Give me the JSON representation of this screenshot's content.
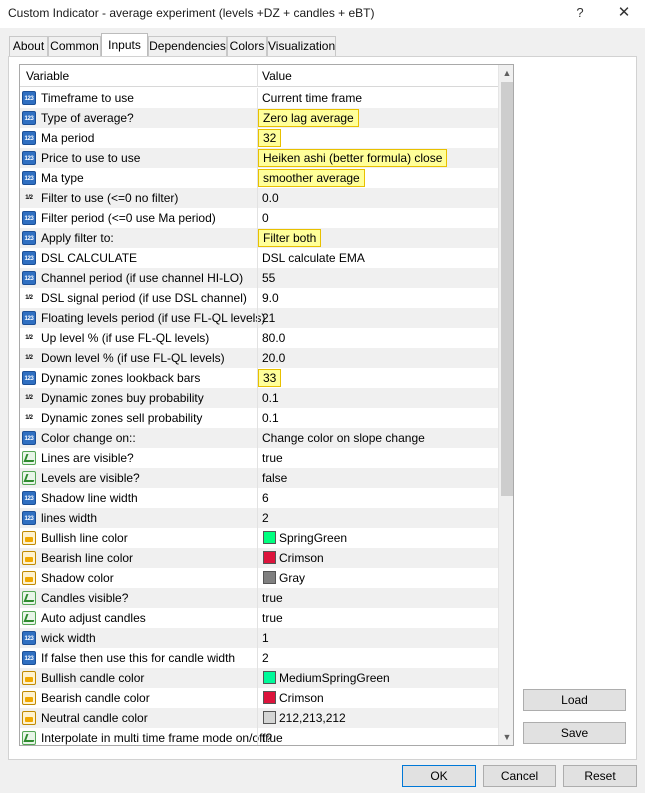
{
  "window": {
    "title": "Custom Indicator - average experiment (levels +DZ + candles + eBT)",
    "help_glyph": "?",
    "close_glyph": "✕"
  },
  "tabs": [
    {
      "label": "About"
    },
    {
      "label": "Common"
    },
    {
      "label": "Inputs",
      "active": true
    },
    {
      "label": "Dependencies"
    },
    {
      "label": "Colors"
    },
    {
      "label": "Visualization"
    }
  ],
  "grid": {
    "header": {
      "variable": "Variable",
      "value": "Value"
    },
    "type_badges": {
      "int": "123",
      "double": "1/2"
    },
    "rows": [
      {
        "type": "int",
        "variable": "Timeframe to use",
        "value": "Current time frame"
      },
      {
        "type": "int",
        "variable": "Type of average?",
        "value": "Zero lag average",
        "highlight": true
      },
      {
        "type": "int",
        "variable": "Ma period",
        "value": "32",
        "highlight": true
      },
      {
        "type": "int",
        "variable": "Price to use to use",
        "value": "Heiken ashi (better formula) close",
        "highlight": true
      },
      {
        "type": "int",
        "variable": "Ma type",
        "value": "smoother average",
        "highlight": true
      },
      {
        "type": "double",
        "variable": "Filter to use (<=0 no filter)",
        "value": "0.0"
      },
      {
        "type": "int",
        "variable": "Filter period (<=0 use Ma period)",
        "value": "0"
      },
      {
        "type": "int",
        "variable": "Apply filter to:",
        "value": "Filter both",
        "highlight": true
      },
      {
        "type": "int",
        "variable": "DSL CALCULATE",
        "value": "DSL calculate EMA"
      },
      {
        "type": "int",
        "variable": "Channel period (if use channel HI-LO)",
        "value": "55"
      },
      {
        "type": "double",
        "variable": "DSL signal period (if use DSL channel)",
        "value": "9.0"
      },
      {
        "type": "int",
        "variable": "Floating levels period (if use FL-QL levels)",
        "value": "21"
      },
      {
        "type": "double",
        "variable": "Up level % (if use FL-QL levels)",
        "value": "80.0"
      },
      {
        "type": "double",
        "variable": "Down level % (if use FL-QL levels)",
        "value": "20.0"
      },
      {
        "type": "int",
        "variable": "Dynamic zones lookback bars",
        "value": "33",
        "highlight": true
      },
      {
        "type": "double",
        "variable": "Dynamic zones buy probability",
        "value": "0.1"
      },
      {
        "type": "double",
        "variable": "Dynamic zones sell probability",
        "value": "0.1"
      },
      {
        "type": "int",
        "variable": "Color change on::",
        "value": "Change color on slope change"
      },
      {
        "type": "bool",
        "variable": "Lines are visible?",
        "value": "true"
      },
      {
        "type": "bool",
        "variable": "Levels are visible?",
        "value": "false"
      },
      {
        "type": "int",
        "variable": "Shadow  line width",
        "value": "6"
      },
      {
        "type": "int",
        "variable": "lines   width",
        "value": "2"
      },
      {
        "type": "color",
        "variable": "Bullish  line  color",
        "value": "SpringGreen",
        "swatch": "#00ff7f"
      },
      {
        "type": "color",
        "variable": "Bearish  line  color",
        "value": "Crimson",
        "swatch": "#dc143c"
      },
      {
        "type": "color",
        "variable": "Shadow  color",
        "value": "Gray",
        "swatch": "#808080"
      },
      {
        "type": "bool",
        "variable": "Candles visible?",
        "value": "true"
      },
      {
        "type": "bool",
        "variable": "Auto adjust candles",
        "value": "true"
      },
      {
        "type": "int",
        "variable": "wick width",
        "value": "1"
      },
      {
        "type": "int",
        "variable": "If  false then use this for candle width",
        "value": "2"
      },
      {
        "type": "color",
        "variable": "Bullish candle  color",
        "value": "MediumSpringGreen",
        "swatch": "#00fa9a"
      },
      {
        "type": "color",
        "variable": "Bearish candle  color",
        "value": "Crimson",
        "swatch": "#dc143c"
      },
      {
        "type": "color",
        "variable": "Neutral candle  color",
        "value": "212,213,212",
        "swatch": "#d4d5d4"
      },
      {
        "type": "bool",
        "variable": "Interpolate in multi time frame mode on/off?",
        "value": "true"
      }
    ]
  },
  "buttons": {
    "load": "Load",
    "save": "Save",
    "ok": "OK",
    "cancel": "Cancel",
    "reset": "Reset"
  },
  "scrollbar": {
    "up_glyph": "▲",
    "down_glyph": "▼"
  }
}
